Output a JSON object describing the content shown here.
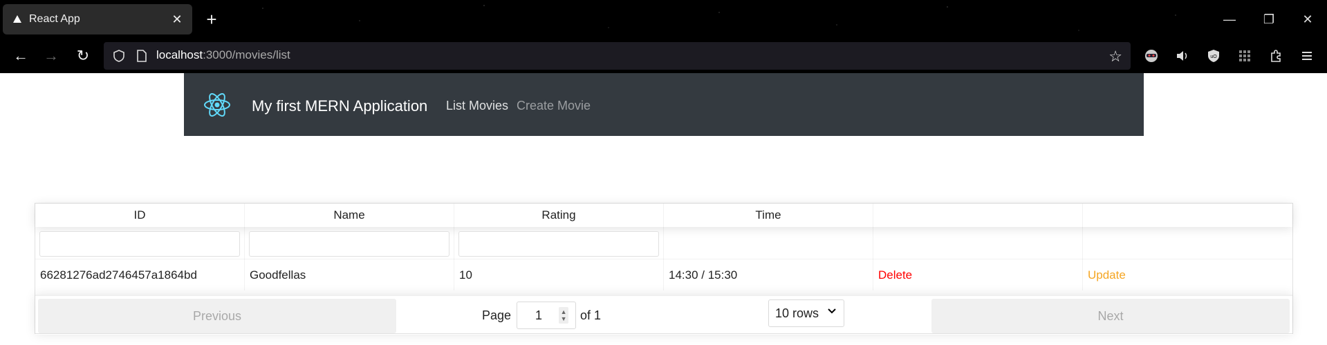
{
  "browser": {
    "tab_title": "React App",
    "url_host": "localhost",
    "url_path": ":3000/movies/list"
  },
  "app": {
    "brand": "My first MERN Application",
    "nav_links": [
      "List Movies",
      "Create Movie"
    ]
  },
  "table": {
    "columns": [
      "ID",
      "Name",
      "Rating",
      "Time",
      "",
      ""
    ],
    "rows": [
      {
        "id": "66281276ad2746457a1864bd",
        "name": "Goodfellas",
        "rating": "10",
        "time": "14:30 / 15:30",
        "delete_label": "Delete",
        "update_label": "Update"
      }
    ]
  },
  "pagination": {
    "previous_label": "Previous",
    "next_label": "Next",
    "page_label": "Page",
    "page_value": "1",
    "of_label": "of 1",
    "rows_option": "10 rows"
  },
  "colors": {
    "navbar_bg": "#343a40",
    "delete": "#ff0000",
    "update": "#f5a623",
    "react_logo": "#61dafb"
  }
}
